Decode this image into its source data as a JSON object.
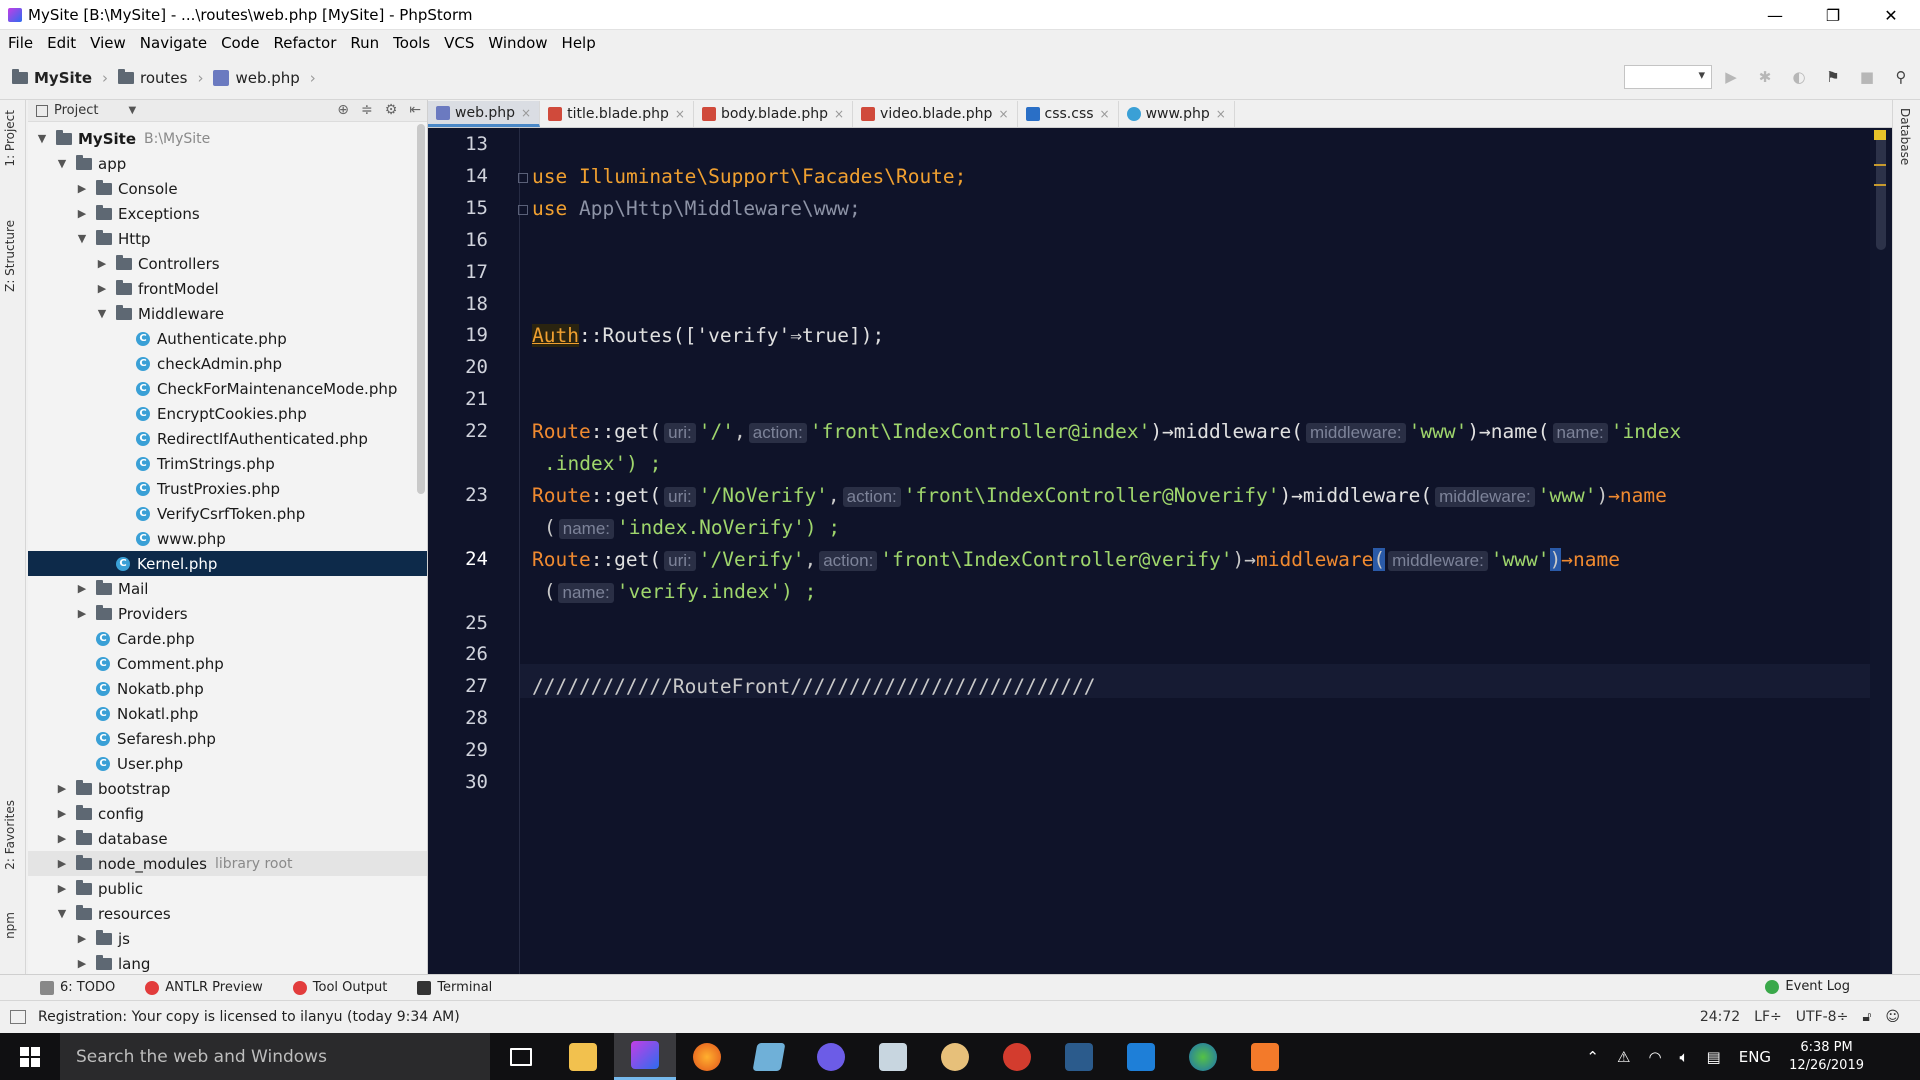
{
  "window": {
    "title": "MySite [B:\\MySite] - ...\\routes\\web.php [MySite] - PhpStorm",
    "controls": {
      "minimize": "—",
      "maximize": "❐",
      "close": "✕"
    }
  },
  "menu": [
    "File",
    "Edit",
    "View",
    "Navigate",
    "Code",
    "Refactor",
    "Run",
    "Tools",
    "VCS",
    "Window",
    "Help"
  ],
  "breadcrumbs": [
    "MySite",
    "routes",
    "web.php"
  ],
  "left_tabs": {
    "project": "1: Project",
    "structure": "Z: Structure",
    "favorites": "2: Favorites",
    "npm": "npm"
  },
  "right_tabs": {
    "database": "Database"
  },
  "project_panel": {
    "title": "Project",
    "tree": [
      {
        "label": "MySite",
        "sub": "B:\\MySite",
        "type": "folder",
        "level": 0,
        "open": true
      },
      {
        "label": "app",
        "type": "folder",
        "level": 1,
        "open": true
      },
      {
        "label": "Console",
        "type": "folder",
        "level": 2,
        "open": false
      },
      {
        "label": "Exceptions",
        "type": "folder",
        "level": 2,
        "open": false
      },
      {
        "label": "Http",
        "type": "folder",
        "level": 2,
        "open": true
      },
      {
        "label": "Controllers",
        "type": "folder",
        "level": 3,
        "open": false
      },
      {
        "label": "frontModel",
        "type": "folder",
        "level": 3,
        "open": false
      },
      {
        "label": "Middleware",
        "type": "folder",
        "level": 3,
        "open": true
      },
      {
        "label": "Authenticate.php",
        "type": "class",
        "level": 4
      },
      {
        "label": "checkAdmin.php",
        "type": "class",
        "level": 4
      },
      {
        "label": "CheckForMaintenanceMode.php",
        "type": "class",
        "level": 4
      },
      {
        "label": "EncryptCookies.php",
        "type": "class",
        "level": 4
      },
      {
        "label": "RedirectIfAuthenticated.php",
        "type": "class",
        "level": 4
      },
      {
        "label": "TrimStrings.php",
        "type": "class",
        "level": 4
      },
      {
        "label": "TrustProxies.php",
        "type": "class",
        "level": 4
      },
      {
        "label": "VerifyCsrfToken.php",
        "type": "class",
        "level": 4
      },
      {
        "label": "www.php",
        "type": "class",
        "level": 4
      },
      {
        "label": "Kernel.php",
        "type": "class",
        "level": 3,
        "selected": true
      },
      {
        "label": "Mail",
        "type": "folder",
        "level": 2,
        "open": false
      },
      {
        "label": "Providers",
        "type": "folder",
        "level": 2,
        "open": false
      },
      {
        "label": "Carde.php",
        "type": "class",
        "level": 2
      },
      {
        "label": "Comment.php",
        "type": "class",
        "level": 2
      },
      {
        "label": "Nokatb.php",
        "type": "class",
        "level": 2
      },
      {
        "label": "Nokatl.php",
        "type": "class",
        "level": 2
      },
      {
        "label": "Sefaresh.php",
        "type": "class",
        "level": 2
      },
      {
        "label": "User.php",
        "type": "class",
        "level": 2
      },
      {
        "label": "bootstrap",
        "type": "folder",
        "level": 1,
        "open": false
      },
      {
        "label": "config",
        "type": "folder",
        "level": 1,
        "open": false
      },
      {
        "label": "database",
        "type": "folder",
        "level": 1,
        "open": false
      },
      {
        "label": "node_modules",
        "sub": "library root",
        "type": "folder",
        "level": 1,
        "open": false,
        "highlight": true
      },
      {
        "label": "public",
        "type": "folder",
        "level": 1,
        "open": false
      },
      {
        "label": "resources",
        "type": "folder",
        "level": 1,
        "open": true
      },
      {
        "label": "js",
        "type": "folder",
        "level": 2,
        "open": false
      },
      {
        "label": "lang",
        "type": "folder",
        "level": 2,
        "open": false
      }
    ]
  },
  "tabs": [
    {
      "label": "web.php",
      "icon": "php",
      "active": true
    },
    {
      "label": "title.blade.php",
      "icon": "blade"
    },
    {
      "label": "body.blade.php",
      "icon": "blade"
    },
    {
      "label": "video.blade.php",
      "icon": "blade"
    },
    {
      "label": "css.css",
      "icon": "css"
    },
    {
      "label": "www.php",
      "icon": "class"
    }
  ],
  "editor": {
    "line_numbers": [
      "13",
      "14",
      "15",
      "16",
      "17",
      "18",
      "19",
      "20",
      "21",
      "22",
      "23",
      "24",
      "25",
      "26",
      "27",
      "28",
      "29",
      "30"
    ],
    "current_line": "24",
    "code": {
      "l14_use": "use",
      "l14_path": "Illuminate\\Support\\Facades\\Route;",
      "l15_use": "use",
      "l15_path": "App\\Http\\Middleware\\www;",
      "l19_auth": "Auth",
      "l19_rest": "::Routes(['verify'⇒true]);",
      "route": "Route",
      "get": "::get(",
      "hint_uri": "uri:",
      "hint_action": "action:",
      "hint_middleware": "middleware:",
      "hint_name": "name:",
      "arrow_middleware": ")→middleware(",
      "arrow_name": ")→name(",
      "l22_uri": "'/'",
      "l22_action": "'front\\IndexController@index'",
      "l22_mw": "'www'",
      "l22_name_a": "'index",
      "l22_name_b": ".index') ;",
      "l23_uri": "'/NoVerify'",
      "l23_action": "'front\\IndexController@Noverify'",
      "l23_mw": "'www'",
      "l23_name_tail": "→name",
      "l23_cont": "'index.NoVerify') ;",
      "l24_uri": "'/Verify'",
      "l24_action": "'front\\IndexController@verify'",
      "l24_mw": "'www'",
      "l24_name_tail": "→name",
      "l24_cont": "'verify.index') ;",
      "l27_comment": "////////////RouteFront//////////////////////////"
    }
  },
  "tool_tabs": {
    "todo": "6: TODO",
    "antlr": "ANTLR Preview",
    "tool_output": "Tool Output",
    "terminal": "Terminal",
    "event_log": "Event Log"
  },
  "status": {
    "message": "Registration: Your copy is licensed to ilanyu (today 9:34 AM)",
    "position": "24:72",
    "line_sep": "LF÷",
    "encoding": "UTF-8÷"
  },
  "taskbar": {
    "search_placeholder": "Search the web and Windows",
    "lang": "ENG",
    "time": "6:38 PM",
    "date": "12/26/2019"
  },
  "colors": {
    "editor_bg": "#0f1329",
    "keyword": "#f0a030",
    "string": "#9fd66c",
    "selection": "#0d2a4a"
  }
}
